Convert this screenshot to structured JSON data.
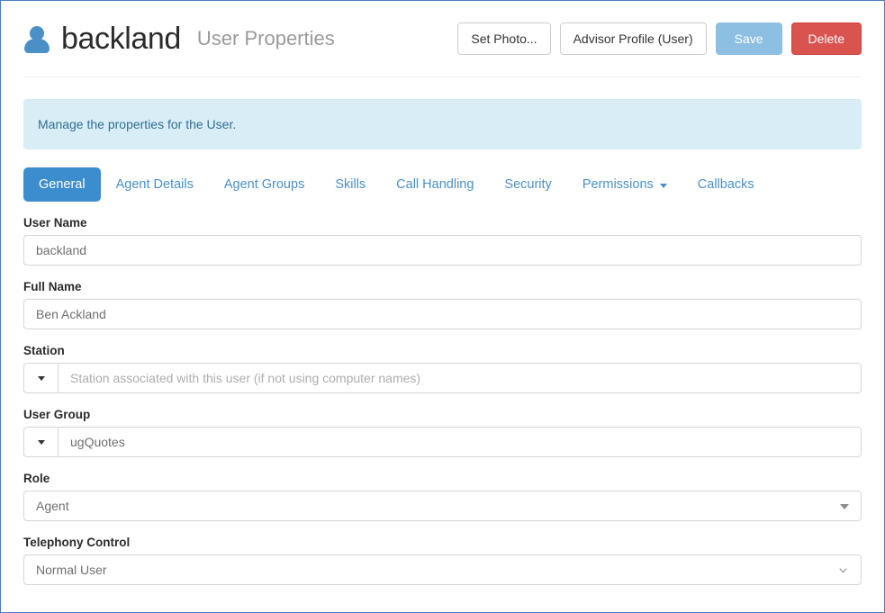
{
  "header": {
    "icon": "person-icon",
    "title": "backland",
    "subtitle": "User Properties",
    "buttons": [
      {
        "label": "Set Photo...",
        "style": "default"
      },
      {
        "label": "Advisor Profile (User)",
        "style": "default"
      },
      {
        "label": "Save",
        "style": "primary"
      },
      {
        "label": "Delete",
        "style": "danger"
      }
    ]
  },
  "alert": {
    "text": "Manage the properties for the User."
  },
  "tabs": [
    {
      "label": "General",
      "active": true,
      "caret": false
    },
    {
      "label": "Agent Details",
      "active": false,
      "caret": false
    },
    {
      "label": "Agent Groups",
      "active": false,
      "caret": false
    },
    {
      "label": "Skills",
      "active": false,
      "caret": false
    },
    {
      "label": "Call Handling",
      "active": false,
      "caret": false
    },
    {
      "label": "Security",
      "active": false,
      "caret": false
    },
    {
      "label": "Permissions",
      "active": false,
      "caret": true
    },
    {
      "label": "Callbacks",
      "active": false,
      "caret": false
    }
  ],
  "form": {
    "user_name": {
      "label": "User Name",
      "value": "backland"
    },
    "full_name": {
      "label": "Full Name",
      "value": "Ben Ackland"
    },
    "station": {
      "label": "Station",
      "value": "",
      "placeholder": "Station associated with this user (if not using computer names)"
    },
    "user_group": {
      "label": "User Group",
      "value": "ugQuotes"
    },
    "role": {
      "label": "Role",
      "value": "Agent"
    },
    "telephony_control": {
      "label": "Telephony Control",
      "value": "Normal User"
    }
  },
  "colors": {
    "accent": "#3c8dcd",
    "link": "#4a90c7",
    "primary_button": "#8cbfe2",
    "danger": "#d9534f",
    "alert_bg": "#d9edf7",
    "alert_text": "#31708f",
    "window_border": "#4a7ebb"
  }
}
